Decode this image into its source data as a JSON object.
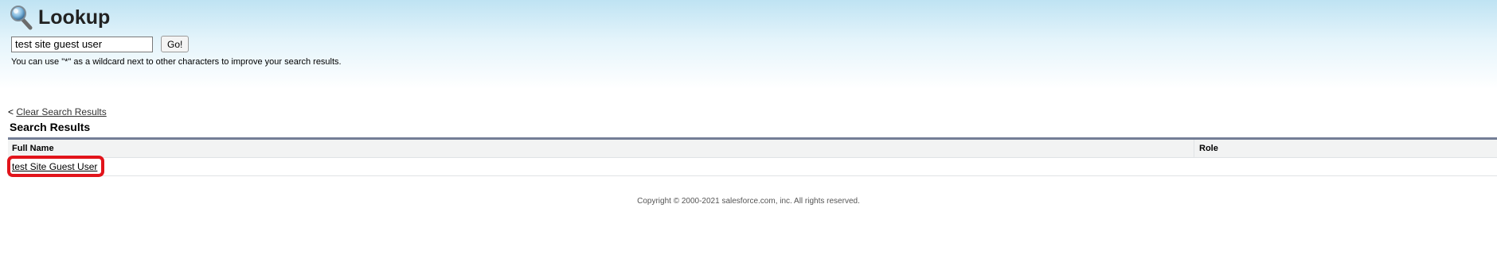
{
  "header": {
    "title": "Lookup",
    "icon": "magnifier-icon"
  },
  "search": {
    "value": "test site guest user",
    "go_label": "Go!",
    "hint": "You can use \"*\" as a wildcard next to other characters to improve your search results."
  },
  "results": {
    "clear_prefix": "<",
    "clear_label": "Clear Search Results",
    "title": "Search Results",
    "columns": [
      "Full Name",
      "Role"
    ],
    "rows": [
      {
        "full_name": "test Site Guest User",
        "role": ""
      }
    ]
  },
  "footer": {
    "copyright": "Copyright © 2000-2021 salesforce.com, inc. All rights reserved."
  },
  "colors": {
    "highlight": "#e2141b",
    "table_rule": "#747e96"
  }
}
